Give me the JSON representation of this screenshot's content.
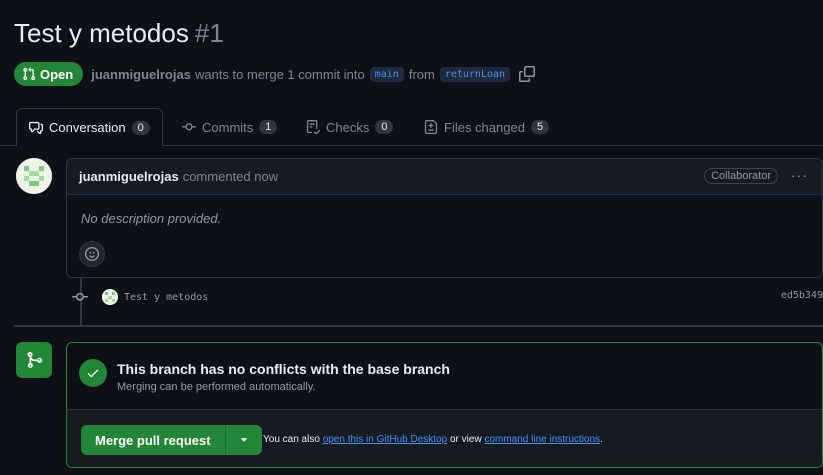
{
  "pr": {
    "title": "Test y metodos",
    "number": "#1",
    "state": "Open",
    "author": "juanmiguelrojas",
    "merge_text": "wants to merge 1 commit into",
    "base_branch": "main",
    "from_text": "from",
    "head_branch": "returnLoan"
  },
  "tabs": [
    {
      "label": "Conversation",
      "count": "0",
      "icon": "comment-discussion-icon"
    },
    {
      "label": "Commits",
      "count": "1",
      "icon": "git-commit-icon"
    },
    {
      "label": "Checks",
      "count": "0",
      "icon": "checklist-icon"
    },
    {
      "label": "Files changed",
      "count": "5",
      "icon": "file-diff-icon"
    }
  ],
  "comment": {
    "author": "juanmiguelrojas",
    "action": "commented now",
    "role": "Collaborator",
    "menu": "···",
    "body": "No description provided."
  },
  "commit": {
    "message": "Test y metodos",
    "sha": "ed5b349"
  },
  "merge": {
    "title": "This branch has no conflicts with the base branch",
    "subtitle": "Merging can be performed automatically.",
    "button_label": "Merge pull request",
    "note_prefix": "You can also",
    "desktop_link": "open this in GitHub Desktop",
    "note_middle": "or view",
    "cli_link": "command line instructions",
    "note_suffix": "."
  },
  "colors": {
    "background": "#0d1117",
    "accent_green": "#238636",
    "link_blue": "#4493f8",
    "border": "#30363d"
  }
}
